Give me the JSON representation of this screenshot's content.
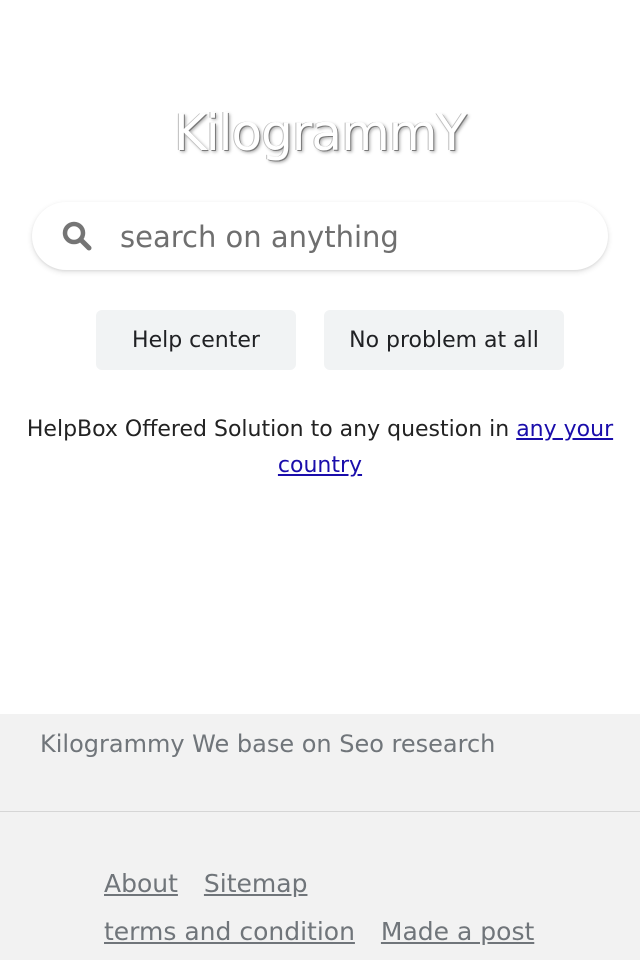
{
  "logo": {
    "text": "KilogrammY"
  },
  "search": {
    "placeholder": "search on anything"
  },
  "buttons": {
    "help_center": "Help center",
    "no_problem": "No problem at all"
  },
  "tagline": {
    "text": "HelpBox Offered Solution to any question in ",
    "link_text": "any your country"
  },
  "footer": {
    "text": "Kilogrammy We base on Seo research",
    "links": [
      "About",
      "Sitemap",
      "terms and condition",
      "Made a post"
    ]
  },
  "colors": {
    "link": "#1a0dab",
    "footer_bg": "#f2f2f2",
    "button_bg": "#f1f3f4",
    "footer_text": "#70757a"
  },
  "icons": {
    "search": "search-icon"
  }
}
